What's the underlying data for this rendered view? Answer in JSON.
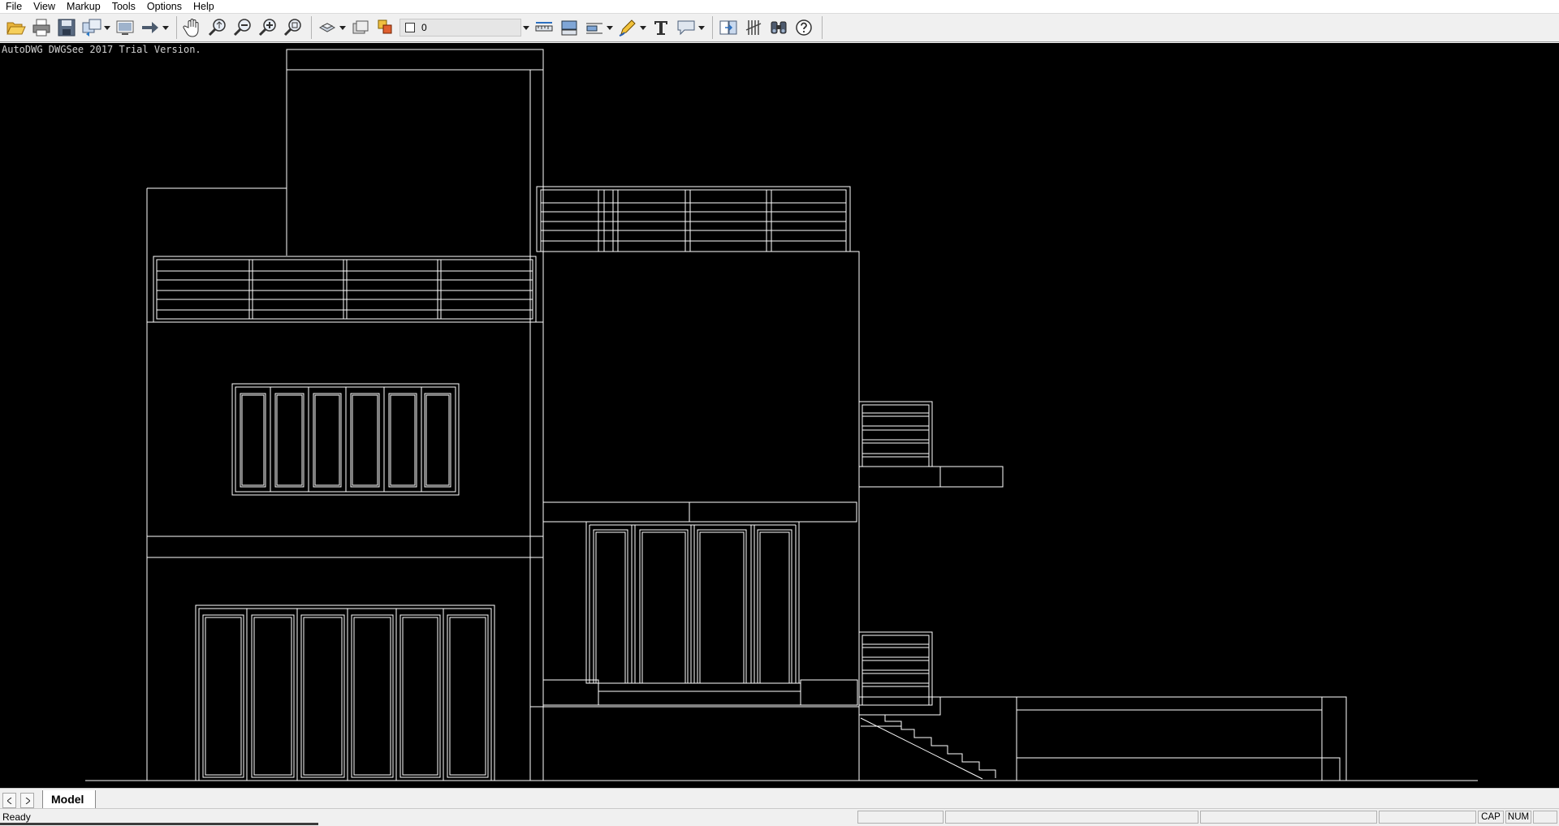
{
  "menu": [
    "File",
    "View",
    "Markup",
    "Tools",
    "Options",
    "Help"
  ],
  "toolbar": {
    "layer_value": "0",
    "icons": [
      "open-folder-icon",
      "print-icon",
      "save-icon",
      "convert-icon",
      "layout-icon",
      "arrow-icon",
      "pan-hand-icon",
      "zoom-realtime-icon",
      "zoom-out-icon",
      "zoom-in-icon",
      "zoom-extents-icon",
      "layer-icon",
      "layer-manager-icon",
      "measure-distance-icon",
      "measure-area-icon",
      "dimension-icon",
      "pen-markup-icon",
      "text-icon",
      "callout-icon",
      "compare-icon",
      "hatch-icon",
      "find-icon",
      "help-icon"
    ]
  },
  "canvas": {
    "trial_notice": "AutoDWG DWGSee 2017 Trial Version.",
    "background": "#000000",
    "line_color": "#ffffff"
  },
  "tabs": {
    "model_label": "Model"
  },
  "status": {
    "text": "Ready",
    "cap": "CAP",
    "num": "NUM"
  }
}
